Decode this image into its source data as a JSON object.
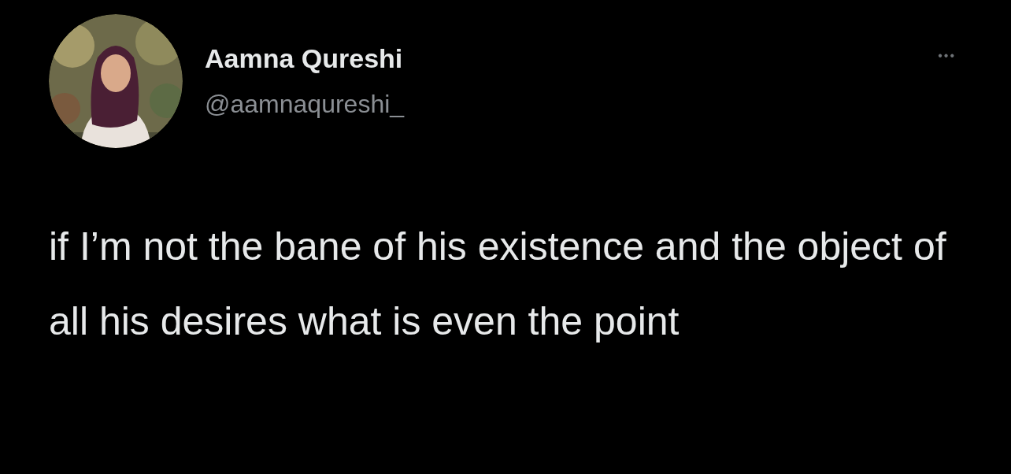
{
  "tweet": {
    "author_name": "Aamna Qureshi",
    "handle": "@aamnaqureshi_",
    "menu": "•••",
    "text": "if I’m not the bane of his existence and the object of all his desires what is even the point"
  }
}
